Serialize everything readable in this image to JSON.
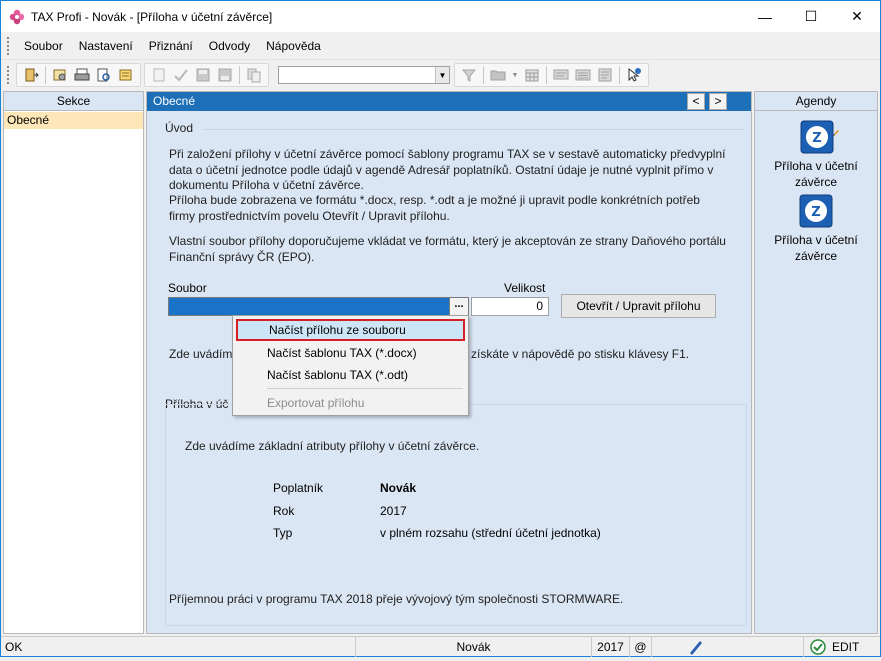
{
  "window": {
    "title": "TAX Profi - Novák - [Příloha v účetní závěrce]",
    "controls": {
      "minimize": "—",
      "maximize": "☐",
      "close": "✕"
    }
  },
  "menu": {
    "items": [
      {
        "label": "Soubor"
      },
      {
        "label": "Nastavení"
      },
      {
        "label": "Přiznání"
      },
      {
        "label": "Odvody"
      },
      {
        "label": "Nápověda"
      }
    ]
  },
  "toolbar": {
    "combo_value": ""
  },
  "left_pane": {
    "header": "Sekce",
    "items": [
      {
        "label": "Obecné"
      }
    ]
  },
  "center": {
    "header": "Obecné",
    "nav_prev": "<",
    "nav_next": ">",
    "uvod": {
      "title": "Úvod",
      "para1": "Při založení přílohy v účetní závěrce pomocí šablony programu TAX se v sestavě automaticky předvyplní data o účetní jednotce podle údajů v agendě Adresář poplatníků. Ostatní údaje je nutné vyplnit přímo v dokumentu Příloha v účetní závěrce.",
      "para2": "Příloha bude zobrazena ve formátu *.docx, resp. *.odt a je možné ji upravit podle konkrétních potřeb firmy prostřednictvím povelu Otevřít / Upravit přílohu.",
      "para3": "Vlastní soubor přílohy doporučujeme vkládat ve formátu, který je akceptován ze strany Daňového portálu Finanční správy ČR (EPO).",
      "soubor_label": "Soubor",
      "velikost_label": "Velikost",
      "ellipsis": "...",
      "size_value": "0",
      "open_button": "Otevřít / Upravit přílohu",
      "hint_left": "Zde uvádím",
      "hint_right": "získáte v nápovědě po stisku klávesy F1."
    },
    "attr": {
      "title": "Příloha v úč",
      "intro": "Zde uvádíme základní atributy přílohy v účetní závěrce.",
      "rows": [
        {
          "label": "Poplatník",
          "value": "Novák"
        },
        {
          "label": "Rok",
          "value": "2017"
        },
        {
          "label": "Typ",
          "value": "v plném rozsahu (střední účetní jednotka)"
        }
      ],
      "footer": "Příjemnou práci v programu TAX 2018 přeje vývojový tým společnosti STORMWARE."
    }
  },
  "context_menu": {
    "items": [
      {
        "label": "Načíst přílohu ze souboru",
        "state": "selected"
      },
      {
        "label": "Načíst šablonu TAX (*.docx)",
        "state": "normal"
      },
      {
        "label": "Načíst šablonu TAX (*.odt)",
        "state": "normal"
      },
      {
        "label": "Exportovat přílohu",
        "state": "disabled"
      }
    ]
  },
  "right_pane": {
    "header": "Agendy",
    "items": [
      {
        "label_line1": "Příloha v účetní",
        "label_line2": "závěrce",
        "icon": "document-edit-icon"
      },
      {
        "label_line1": "Příloha v účetní",
        "label_line2": "závěrce",
        "icon": "document-icon"
      }
    ]
  },
  "statusbar": {
    "left": "OK",
    "name": "Novák",
    "year": "2017",
    "at": "@",
    "mode": "EDIT"
  },
  "colors": {
    "header_blue": "#1d6fb8",
    "selection_border": "#d31f25",
    "left_selected": "#fde7b8",
    "pane_bg": "#dbe6f4"
  }
}
